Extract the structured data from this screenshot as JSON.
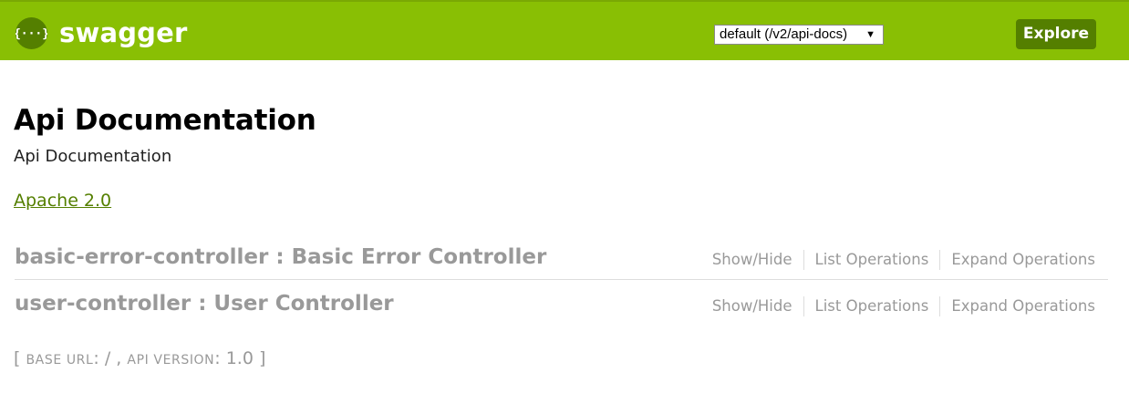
{
  "header": {
    "logo_text": "swagger",
    "logo_icon": "swagger-braces-icon",
    "api_select_value": "default (/v2/api-docs)",
    "explore_label": "Explore",
    "colors": {
      "bar": "#89bf04",
      "dark": "#547f00"
    }
  },
  "info": {
    "title": "Api Documentation",
    "description": "Api Documentation",
    "license_text": "Apache 2.0"
  },
  "resources": [
    {
      "title": "basic-error-controller : Basic Error Controller",
      "ops": [
        "Show/Hide",
        "List Operations",
        "Expand Operations"
      ]
    },
    {
      "title": "user-controller : User Controller",
      "ops": [
        "Show/Hide",
        "List Operations",
        "Expand Operations"
      ]
    }
  ],
  "footer": {
    "open_bracket": "[",
    "base_url_label": "BASE URL",
    "base_url_sep": ": / , ",
    "api_version_label": "API VERSION",
    "api_version_sep": ": ",
    "api_version_value": "1.0",
    "close_bracket": " ]"
  }
}
